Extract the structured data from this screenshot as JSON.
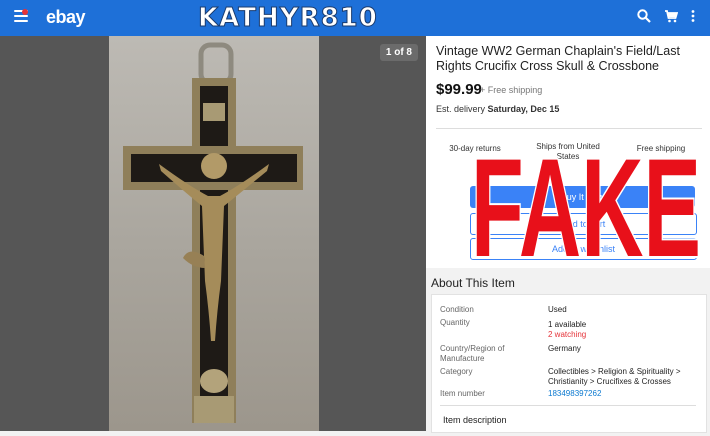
{
  "header": {
    "logo": "ebay",
    "watermark": "KATHYR810"
  },
  "icons": {
    "menu": "menu-icon",
    "search": "search-icon",
    "cart": "cart-icon",
    "more": "more-vert-icon"
  },
  "image_viewer": {
    "counter": "1 of 8"
  },
  "listing": {
    "title": "Vintage WW2 German Chaplain's Field/Last Rights Crucifix Cross Skull & Crossbone",
    "price": "$99.99",
    "shipping": "+ Free shipping",
    "delivery_prefix": "Est. delivery",
    "delivery_date": "Saturday, Dec 15",
    "features": [
      "30-day returns",
      "Ships from United States",
      "Free shipping"
    ],
    "buttons": {
      "buy": "Buy It Now",
      "cart": "Add to cart",
      "watch": "Add to watchlist"
    }
  },
  "overlay": {
    "stamp": "FAKE"
  },
  "about": {
    "heading": "About This Item",
    "rows": [
      {
        "label": "Condition",
        "value": "Used"
      },
      {
        "label": "Quantity",
        "value": "1 available",
        "extra": "2 watching"
      },
      {
        "label": "Country/Region of Manufacture",
        "value": "Germany"
      },
      {
        "label": "Category",
        "value": "Collectibles > Religion & Spirituality > Christianity > Crucifixes & Crosses"
      },
      {
        "label": "Item number",
        "value": "183498397262"
      }
    ],
    "description_heading": "Item description"
  },
  "colors": {
    "brand": "#1e70d8",
    "accent": "#3a82f7",
    "stamp": "#e8101a",
    "alert": "#e53238",
    "link": "#0b79d0"
  }
}
